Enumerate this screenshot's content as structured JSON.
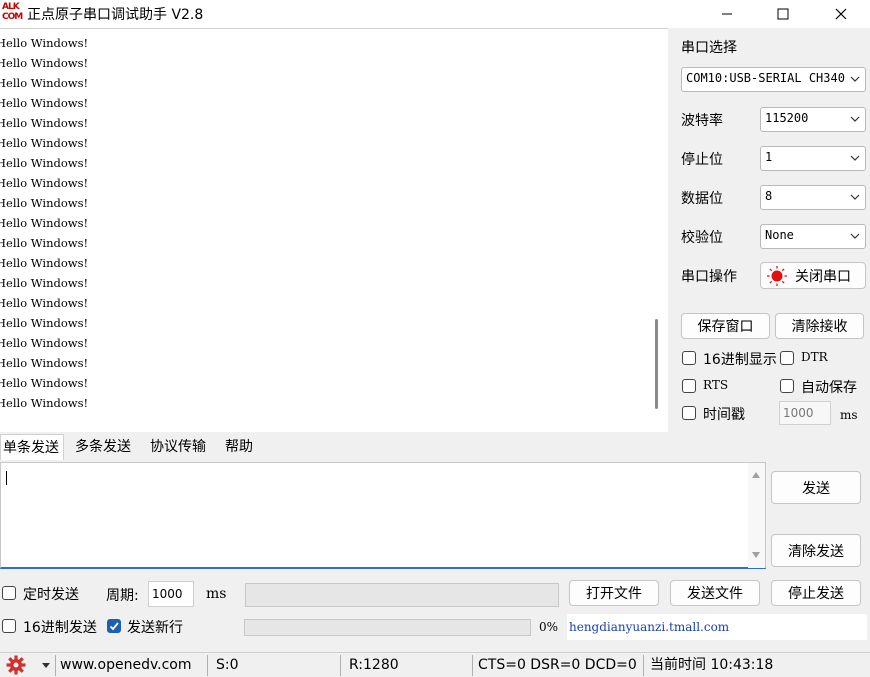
{
  "window": {
    "logo_top": "ALK",
    "logo_bottom": "COM",
    "title": "正点原子串口调试助手 V2.8"
  },
  "receive": {
    "lines": [
      "Hello Windows!",
      "Hello Windows!",
      "Hello Windows!",
      "Hello Windows!",
      "Hello Windows!",
      "Hello Windows!",
      "Hello Windows!",
      "Hello Windows!",
      "Hello Windows!",
      "Hello Windows!",
      "Hello Windows!",
      "Hello Windows!",
      "Hello Windows!",
      "Hello Windows!",
      "Hello Windows!",
      "Hello Windows!",
      "Hello Windows!",
      "Hello Windows!",
      "Hello Windows!"
    ]
  },
  "settings": {
    "port_label": "串口选择",
    "port_value": "COM10:USB-SERIAL CH340",
    "baud_label": "波特率",
    "baud_value": "115200",
    "stop_label": "停止位",
    "stop_value": "1",
    "data_label": "数据位",
    "data_value": "8",
    "parity_label": "校验位",
    "parity_value": "None",
    "op_label": "串口操作",
    "op_button": "关闭串口",
    "save_window": "保存窗口",
    "clear_receive": "清除接收",
    "hex_display": "16进制显示",
    "dtr": "DTR",
    "rts": "RTS",
    "auto_save": "自动保存",
    "timestamp": "时间戳",
    "timestamp_value": "1000",
    "timestamp_unit": "ms"
  },
  "tabs": [
    "单条发送",
    "多条发送",
    "协议传输",
    "帮助"
  ],
  "send": {
    "send_button": "发送",
    "clear_send_button": "清除发送",
    "timed_send": "定时发送",
    "period_label": "周期:",
    "period_value": "1000",
    "period_unit": "ms",
    "open_file": "打开文件",
    "send_file": "发送文件",
    "stop_send": "停止发送",
    "hex_send": "16进制发送",
    "send_newline": "发送新行",
    "progress_text": "0%",
    "progress": 0,
    "shop_link": "hengdianyuanzi.tmall.com"
  },
  "status": {
    "url": "www.openedv.com",
    "sent": "S:0",
    "received": "R:1280",
    "lines": "CTS=0 DSR=0 DCD=0",
    "time": "当前时间 10:43:18"
  },
  "colors": {
    "accent": "#2a6fc8",
    "logo": "#cc0000",
    "link": "#1a3fb0",
    "gear": "#d0312d"
  }
}
